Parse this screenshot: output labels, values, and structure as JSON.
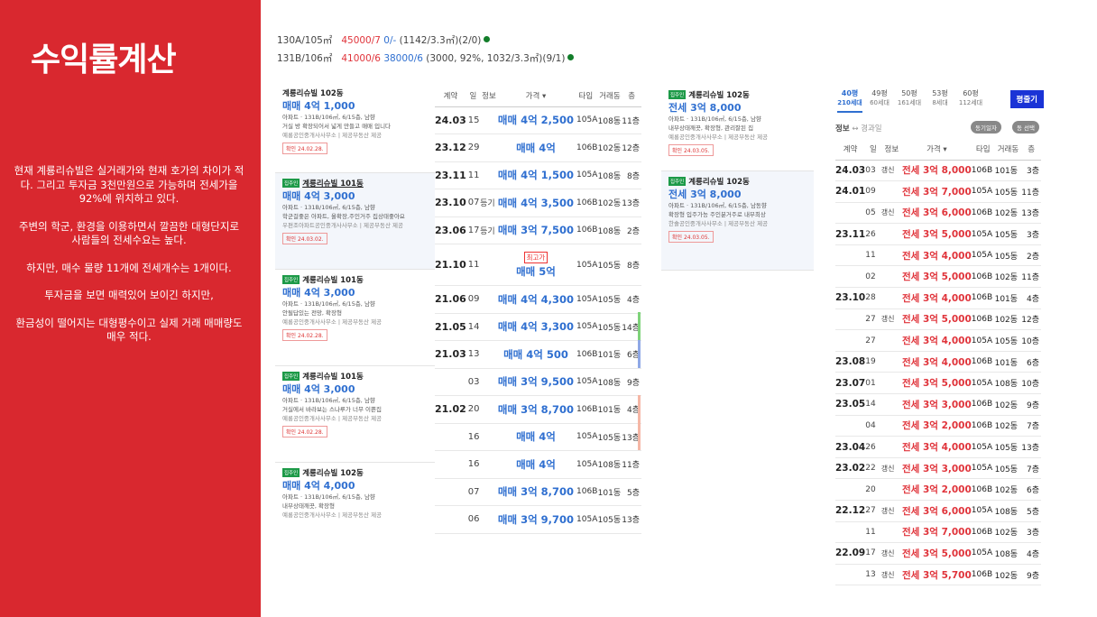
{
  "sidebar": {
    "title": "수익률계산",
    "paragraphs": [
      "현재 계룡리슈빌은 실거래가와 현재 호가의 차이가 적다. 그리고 투자금 3천만원으로 가능하며 전세가을 92%에 위치하고 있다.",
      "주변의 학군, 환경을 이용하면서 깔끔한 대형단지로 사람들의 전세수요는 높다.",
      "하지만, 매수 물량 11개에 전세개수는 1개이다.",
      "투자금을 보면 매력있어 보이긴 하지만,",
      "환금성이 떨어지는 대형평수이고 실제 거래 매매량도 매우 적다."
    ]
  },
  "info": [
    {
      "prefix": "130A/105㎡",
      "red": "45000/7",
      "blue": "0/-",
      "rest": "(1142/3.3㎡)(2/0)"
    },
    {
      "prefix": "131B/106㎡",
      "red": "41000/6",
      "blue": "38000/6",
      "rest": "(3000, 92%, 1032/3.3㎡)(9/1)"
    }
  ],
  "listings": [
    {
      "badge": "",
      "title": "계룡리슈빌 102동",
      "price": "매매 4억 1,000",
      "spec": "아파트 · 131B/106㎡, 6/15층, 남향",
      "desc": "거실 방 확장되어서 넓게 만들고 매매 입니다",
      "agent": "예룡공인중개사사무소 | 제공부동산 제공",
      "date": "확인 24.02.28."
    },
    {
      "badge": "집주인",
      "title": "계룡리슈빌 101동",
      "price": "매매 4억 3,000",
      "spec": "아파트 · 131B/106㎡, 6/15층, 남향",
      "desc": "학군걸좋은 아파트, 올확장,주인거주 집상태좋아요",
      "agent": "우편조아파트공인중개사사무소 | 제공부동산 제공",
      "date": "확인 24.03.02."
    },
    {
      "badge": "집주인",
      "title": "계룡리슈빌 101동",
      "price": "매매 4억 3,000",
      "spec": "아파트 · 131B/106㎡, 6/15층, 남향",
      "desc": "안될답있는 전망, 확장형",
      "agent": "예룡공인중개사사무소 | 제공부동산 제공",
      "date": "확인 24.02.28."
    },
    {
      "badge": "집주인",
      "title": "계룡리슈빌 101동",
      "price": "매매 4억 3,000",
      "spec": "아파트 · 131B/106㎡, 6/15층, 남향",
      "desc": "거실에서 바라보는 스나루가 너무 이쁜집",
      "agent": "예룡공인중개사사무소 | 제공부동산 제공",
      "date": "확인 24.02.28."
    },
    {
      "badge": "집주인",
      "title": "계룡리슈빌 102동",
      "price": "매매 4억 4,000",
      "spec": "아파트 · 131B/106㎡, 6/15층, 남향",
      "desc": "내부상태깨끗, 확장형",
      "agent": "예룡공인중개사사무소 | 제공부동산 제공",
      "date": ""
    }
  ],
  "trade_table": {
    "headers": [
      "계약",
      "일",
      "정보",
      "가격",
      "타입",
      "거래동",
      "층"
    ],
    "rows": [
      {
        "date": "24.03",
        "day": "15",
        "info": "",
        "tag": "",
        "price": "매매 4억 2,500",
        "type": "105A",
        "dong": "108동",
        "floor": "11층"
      },
      {
        "date": "23.12",
        "day": "29",
        "info": "",
        "tag": "",
        "price": "매매 4억",
        "type": "106B",
        "dong": "102동",
        "floor": "12층"
      },
      {
        "date": "23.11",
        "day": "11",
        "info": "",
        "tag": "",
        "price": "매매 4억 1,500",
        "type": "105A",
        "dong": "108동",
        "floor": "8층"
      },
      {
        "date": "23.10",
        "day": "07",
        "info": "등기",
        "tag": "",
        "price": "매매 4억 3,500",
        "type": "106B",
        "dong": "102동",
        "floor": "13층"
      },
      {
        "date": "23.06",
        "day": "17",
        "info": "등기",
        "tag": "",
        "price": "매매 3억 7,500",
        "type": "106B",
        "dong": "108동",
        "floor": "2층"
      },
      {
        "date": "21.10",
        "day": "11",
        "info": "",
        "tag": "최고가",
        "price": "매매 5억",
        "type": "105A",
        "dong": "105동",
        "floor": "8층"
      },
      {
        "date": "21.06",
        "day": "09",
        "info": "",
        "tag": "",
        "price": "매매 4억 4,300",
        "type": "105A",
        "dong": "105동",
        "floor": "4층"
      },
      {
        "date": "21.05",
        "day": "14",
        "info": "",
        "tag": "",
        "price": "매매 4억 3,300",
        "type": "105A",
        "dong": "105동",
        "floor": "14층"
      },
      {
        "date": "21.03",
        "day": "13",
        "info": "",
        "tag": "",
        "price": "매매 4억 500",
        "type": "106B",
        "dong": "101동",
        "floor": "6층"
      },
      {
        "date": "",
        "day": "03",
        "info": "",
        "tag": "",
        "price": "매매 3억 9,500",
        "type": "105A",
        "dong": "108동",
        "floor": "9층"
      },
      {
        "date": "21.02",
        "day": "20",
        "info": "",
        "tag": "",
        "price": "매매 3억 8,700",
        "type": "106B",
        "dong": "101동",
        "floor": "4층"
      },
      {
        "date": "",
        "day": "16",
        "info": "",
        "tag": "",
        "price": "매매 4억",
        "type": "105A",
        "dong": "105동",
        "floor": "13층"
      },
      {
        "date": "",
        "day": "16",
        "info": "",
        "tag": "",
        "price": "매매 4억",
        "type": "105A",
        "dong": "108동",
        "floor": "11층"
      },
      {
        "date": "",
        "day": "07",
        "info": "",
        "tag": "",
        "price": "매매 3억 8,700",
        "type": "106B",
        "dong": "101동",
        "floor": "5층"
      },
      {
        "date": "",
        "day": "06",
        "info": "",
        "tag": "",
        "price": "매매 3억 9,700",
        "type": "105A",
        "dong": "105동",
        "floor": "13층"
      }
    ]
  },
  "rent_listings": [
    {
      "badge": "집주인",
      "title": "계룡리슈빌 102동",
      "price": "전세 3억 8,000",
      "spec": "아파트 · 131B/106㎡, 6/15층, 남향",
      "desc": "내부상태깨끗, 확장형, 관리잘된 집",
      "agent": "예룡공인중개사사무소 | 제공부동산 제공",
      "date": "확인 24.03.05."
    },
    {
      "badge": "집주인",
      "title": "계룡리슈빌 102동",
      "price": "전세 3억 8,000",
      "spec": "아파트 · 131B/106㎡, 6/15층, 남동향",
      "desc": "확장형 입주가능 주인분거주로 내부최상",
      "agent": "한솔공인중개사사무소 | 제공부동산 제공",
      "date": "확인 24.03.05."
    }
  ],
  "size_tabs": [
    {
      "pyeong": "40평",
      "units": "210세대",
      "active": true
    },
    {
      "pyeong": "49평",
      "units": "60세대",
      "active": false
    },
    {
      "pyeong": "50평",
      "units": "161세대",
      "active": false
    },
    {
      "pyeong": "53평",
      "units": "8세대",
      "active": false
    },
    {
      "pyeong": "60평",
      "units": "112세대",
      "active": false
    }
  ],
  "compare_button": "평줄기",
  "filter": {
    "label": "정보",
    "arrow": "↔",
    "sub": "경과일",
    "pill1": "동기일자",
    "pill2": "동 선택"
  },
  "rent_table": {
    "headers": [
      "계약",
      "일",
      "정보",
      "가격",
      "타입",
      "거래동",
      "층"
    ],
    "rows": [
      {
        "date": "24.03",
        "day": "03",
        "info": "갱신",
        "price": "전세 3억 8,000",
        "type": "106B",
        "dong": "101동",
        "floor": "3층"
      },
      {
        "date": "24.01",
        "day": "09",
        "info": "",
        "price": "전세 3억 7,000",
        "type": "105A",
        "dong": "105동",
        "floor": "11층"
      },
      {
        "date": "",
        "day": "05",
        "info": "갱신",
        "price": "전세 3억 6,000",
        "type": "106B",
        "dong": "102동",
        "floor": "13층"
      },
      {
        "date": "23.11",
        "day": "26",
        "info": "",
        "price": "전세 3억 5,000",
        "type": "105A",
        "dong": "105동",
        "floor": "3층"
      },
      {
        "date": "",
        "day": "11",
        "info": "",
        "price": "전세 3억 4,000",
        "type": "105A",
        "dong": "105동",
        "floor": "2층"
      },
      {
        "date": "",
        "day": "02",
        "info": "",
        "price": "전세 3억 5,000",
        "type": "106B",
        "dong": "102동",
        "floor": "11층"
      },
      {
        "date": "23.10",
        "day": "28",
        "info": "",
        "price": "전세 3억 4,000",
        "type": "106B",
        "dong": "101동",
        "floor": "4층"
      },
      {
        "date": "",
        "day": "27",
        "info": "갱신",
        "price": "전세 3억 5,000",
        "type": "106B",
        "dong": "102동",
        "floor": "12층"
      },
      {
        "date": "",
        "day": "27",
        "info": "",
        "price": "전세 3억 4,000",
        "type": "105A",
        "dong": "105동",
        "floor": "10층"
      },
      {
        "date": "23.08",
        "day": "19",
        "info": "",
        "price": "전세 3억 4,000",
        "type": "106B",
        "dong": "101동",
        "floor": "6층"
      },
      {
        "date": "23.07",
        "day": "01",
        "info": "",
        "price": "전세 3억 5,000",
        "type": "105A",
        "dong": "108동",
        "floor": "10층"
      },
      {
        "date": "23.05",
        "day": "14",
        "info": "",
        "price": "전세 3억 3,000",
        "type": "106B",
        "dong": "102동",
        "floor": "9층"
      },
      {
        "date": "",
        "day": "04",
        "info": "",
        "price": "전세 3억 2,000",
        "type": "106B",
        "dong": "102동",
        "floor": "7층"
      },
      {
        "date": "23.04",
        "day": "26",
        "info": "",
        "price": "전세 3억 4,000",
        "type": "105A",
        "dong": "105동",
        "floor": "13층"
      },
      {
        "date": "23.02",
        "day": "22",
        "info": "갱신",
        "price": "전세 3억 3,000",
        "type": "105A",
        "dong": "105동",
        "floor": "7층"
      },
      {
        "date": "",
        "day": "20",
        "info": "",
        "price": "전세 3억 2,000",
        "type": "106B",
        "dong": "102동",
        "floor": "6층"
      },
      {
        "date": "22.12",
        "day": "27",
        "info": "갱신",
        "price": "전세 3억 6,000",
        "type": "105A",
        "dong": "108동",
        "floor": "5층"
      },
      {
        "date": "",
        "day": "11",
        "info": "",
        "price": "전세 3억 7,000",
        "type": "106B",
        "dong": "102동",
        "floor": "3층"
      },
      {
        "date": "22.09",
        "day": "17",
        "info": "갱신",
        "price": "전세 3억 5,000",
        "type": "105A",
        "dong": "108동",
        "floor": "4층"
      },
      {
        "date": "",
        "day": "13",
        "info": "갱신",
        "price": "전세 3억 5,700",
        "type": "106B",
        "dong": "102동",
        "floor": "9층"
      }
    ]
  },
  "colors": {
    "sidebar_bg": "#d9282f",
    "sale_price": "#2f6fd0",
    "rent_price": "#e0343b",
    "accent_button": "#1a33d6",
    "owner_badge": "#1d9a48"
  }
}
